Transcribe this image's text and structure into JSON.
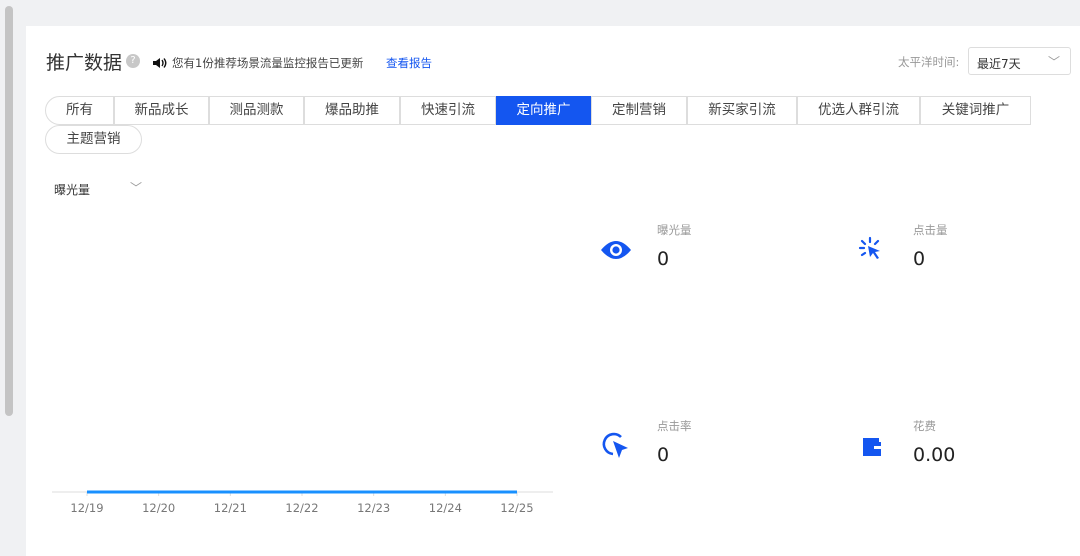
{
  "header": {
    "title": "推广数据",
    "help_icon": "?",
    "notice": "您有1份推荐场景流量监控报告已更新",
    "link": "查看报告",
    "timezone_label": "太平洋时间:",
    "range_select": "最近7天"
  },
  "tabs": [
    {
      "label": "所有"
    },
    {
      "label": "新品成长"
    },
    {
      "label": "测品测款"
    },
    {
      "label": "爆品助推"
    },
    {
      "label": "快速引流"
    },
    {
      "label": "定向推广",
      "active": true
    },
    {
      "label": "定制营销"
    },
    {
      "label": "新买家引流"
    },
    {
      "label": "优选人群引流"
    },
    {
      "label": "关键词推广"
    },
    {
      "label": "主题营销"
    }
  ],
  "metric_select": "曝光量",
  "stats": [
    {
      "label": "曝光量",
      "value": "0",
      "icon": "eye-icon"
    },
    {
      "label": "点击量",
      "value": "0",
      "icon": "click-icon"
    },
    {
      "label": "点击率",
      "value": "0",
      "icon": "click-rate-icon"
    },
    {
      "label": "花费",
      "value": "0.00",
      "icon": "wallet-icon"
    }
  ],
  "accent": "#1456f0",
  "chart_data": {
    "type": "line",
    "categories": [
      "12/19",
      "12/20",
      "12/21",
      "12/22",
      "12/23",
      "12/24",
      "12/25"
    ],
    "values": [
      0,
      0,
      0,
      0,
      0,
      0,
      0
    ],
    "color": "#1890ff"
  }
}
